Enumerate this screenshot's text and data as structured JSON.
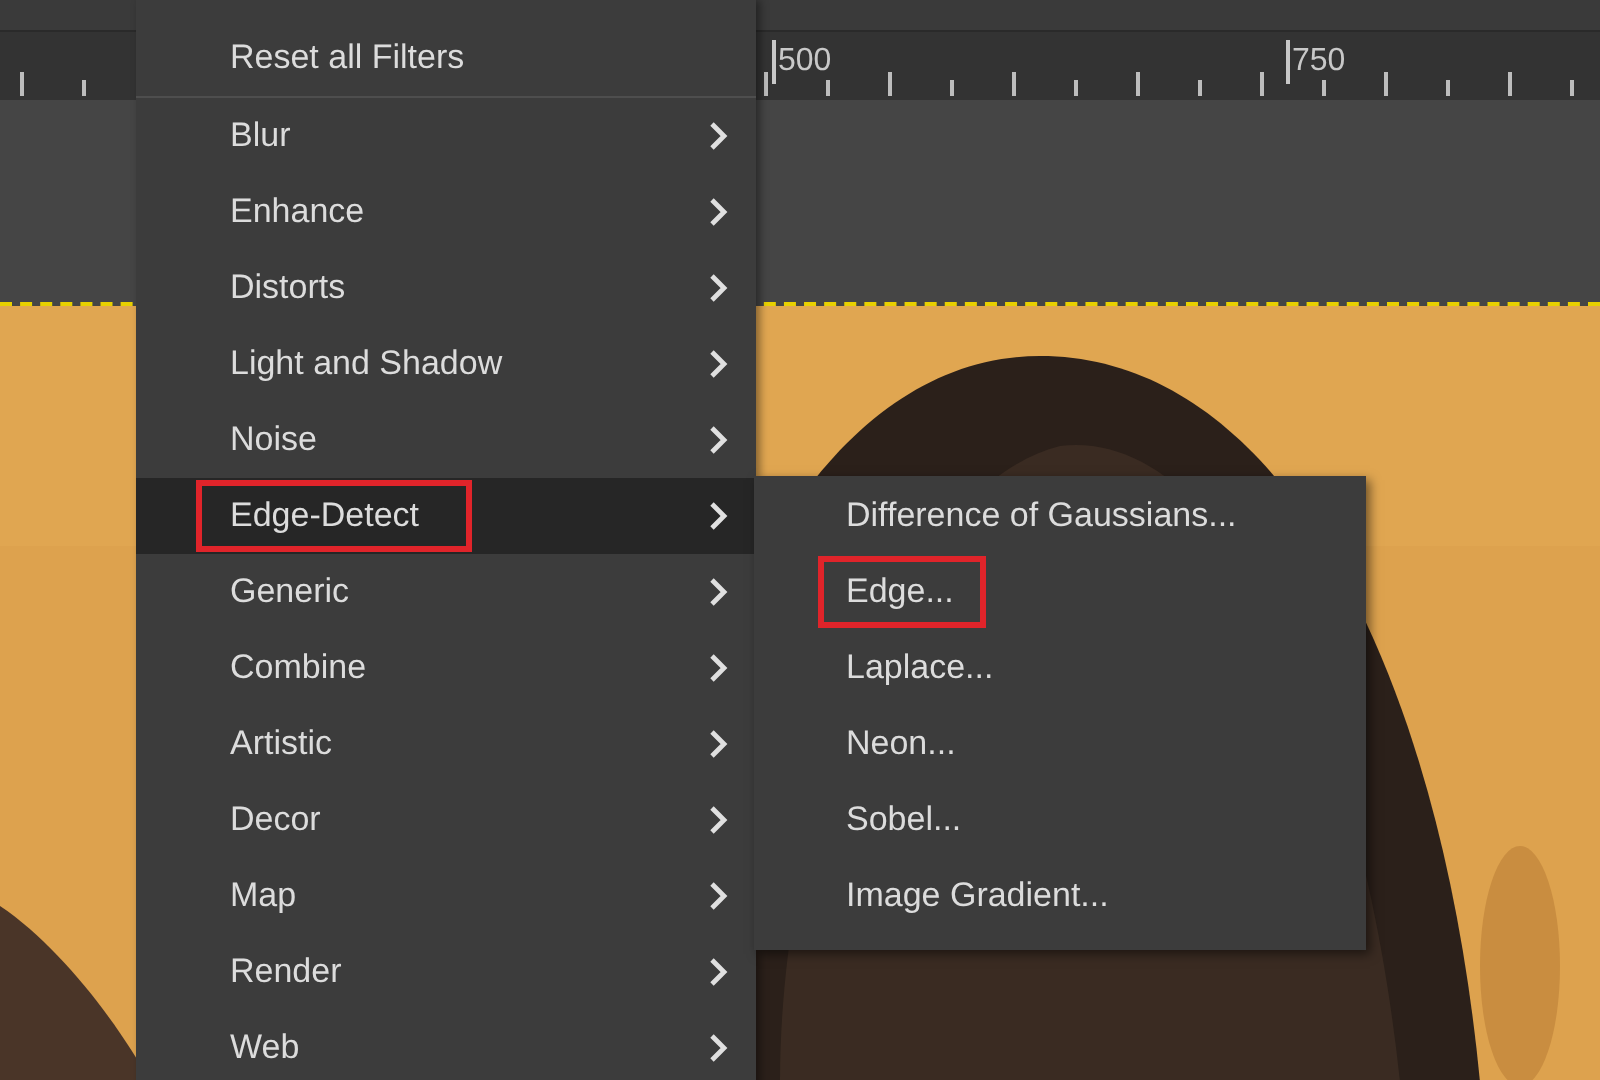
{
  "ruler": {
    "labels": [
      "500",
      "750"
    ]
  },
  "menu": {
    "items": [
      {
        "label": "Reset all Filters",
        "kind": "action",
        "selected": false,
        "annotated": false
      },
      {
        "label": "Blur",
        "kind": "submenu",
        "selected": false,
        "annotated": false
      },
      {
        "label": "Enhance",
        "kind": "submenu",
        "selected": false,
        "annotated": false
      },
      {
        "label": "Distorts",
        "kind": "submenu",
        "selected": false,
        "annotated": false
      },
      {
        "label": "Light and Shadow",
        "kind": "submenu",
        "selected": false,
        "annotated": false
      },
      {
        "label": "Noise",
        "kind": "submenu",
        "selected": false,
        "annotated": false
      },
      {
        "label": "Edge-Detect",
        "kind": "submenu",
        "selected": true,
        "annotated": true
      },
      {
        "label": "Generic",
        "kind": "submenu",
        "selected": false,
        "annotated": false
      },
      {
        "label": "Combine",
        "kind": "submenu",
        "selected": false,
        "annotated": false
      },
      {
        "label": "Artistic",
        "kind": "submenu",
        "selected": false,
        "annotated": false
      },
      {
        "label": "Decor",
        "kind": "submenu",
        "selected": false,
        "annotated": false
      },
      {
        "label": "Map",
        "kind": "submenu",
        "selected": false,
        "annotated": false
      },
      {
        "label": "Render",
        "kind": "submenu",
        "selected": false,
        "annotated": false
      },
      {
        "label": "Web",
        "kind": "submenu",
        "selected": false,
        "annotated": false
      }
    ]
  },
  "submenu": {
    "items": [
      {
        "label": "Difference of Gaussians...",
        "annotated": false
      },
      {
        "label": "Edge...",
        "annotated": true
      },
      {
        "label": "Laplace...",
        "annotated": false
      },
      {
        "label": "Neon...",
        "annotated": false
      },
      {
        "label": "Sobel...",
        "annotated": false
      },
      {
        "label": "Image Gradient...",
        "annotated": false
      }
    ]
  }
}
